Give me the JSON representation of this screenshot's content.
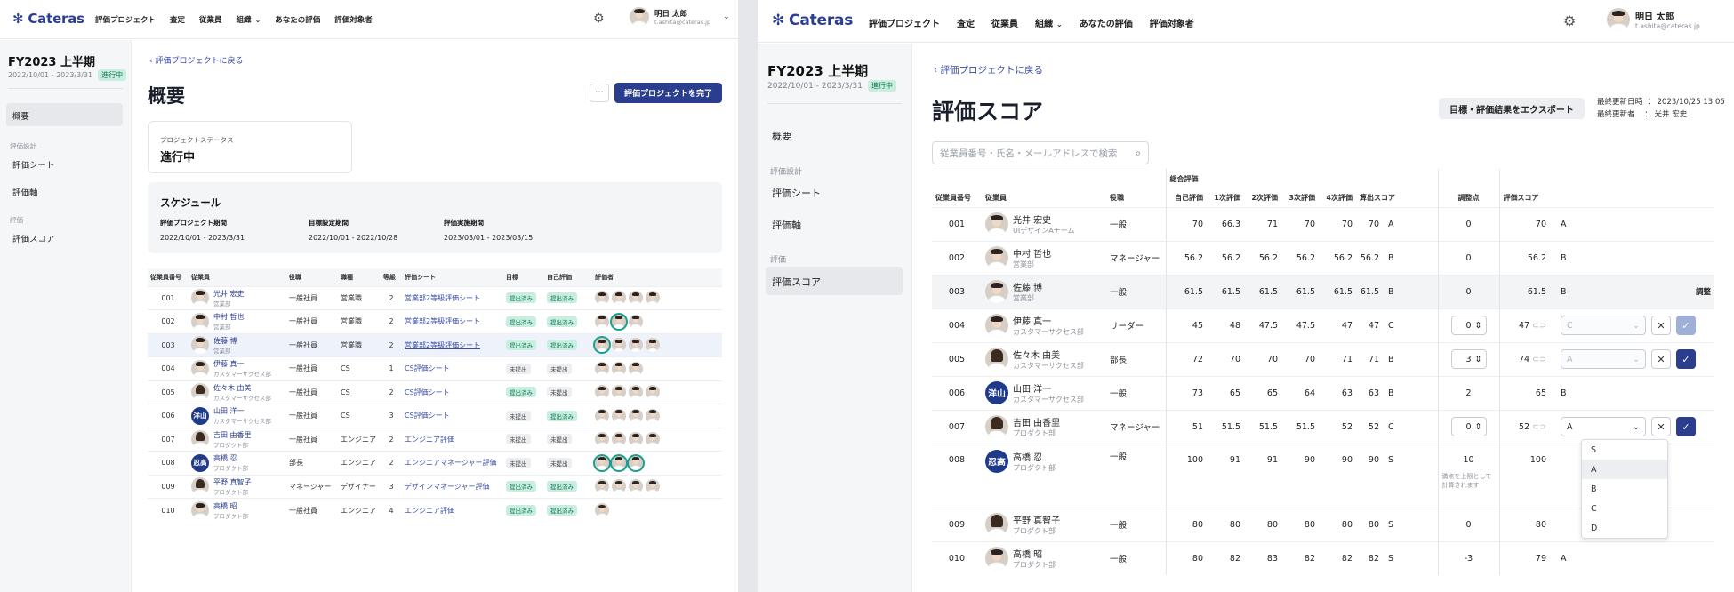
{
  "common": {
    "logo": "Cateras",
    "nav": [
      "評価プロジェクト",
      "査定",
      "従業員",
      "組織",
      "あなたの評価",
      "評価対象者"
    ],
    "user": {
      "name": "明日 太郎",
      "email": "t.ashita@cateras.jp"
    },
    "project": {
      "title": "FY2023 上半期",
      "period": "2022/10/01 - 2023/3/31",
      "status": "進行中"
    },
    "back": "評価プロジェクトに戻る",
    "sidebar": {
      "overview": "概要",
      "section1": "評価設計",
      "sheet": "評価シート",
      "axis": "評価軸",
      "section2": "評価",
      "score": "評価スコア"
    }
  },
  "overview": {
    "title": "概要",
    "complete_button": "評価プロジェクトを完了",
    "more": "···",
    "status_card": {
      "label": "プロジェクトステータス",
      "value": "進行中"
    },
    "schedule": {
      "title": "スケジュール",
      "items": [
        {
          "label": "評価プロジェクト期間",
          "value": "2022/10/01 - 2023/3/31"
        },
        {
          "label": "目標設定期間",
          "value": "2022/10/01 - 2022/10/28"
        },
        {
          "label": "評価実施期間",
          "value": "2023/03/01 - 2023/03/15"
        }
      ]
    },
    "table": {
      "headers": [
        "従業員番号",
        "従業員",
        "役職",
        "職種",
        "等級",
        "評価シート",
        "目標",
        "自己評価",
        "評価者"
      ],
      "rows": [
        {
          "id": "001",
          "name": "光井 宏史",
          "dept": "営業部",
          "role": "一般社員",
          "job": "営業職",
          "grade": "2",
          "sheet": "営業部2等級評価シート",
          "goal": "提出済み",
          "self": "提出済み",
          "ev": 4
        },
        {
          "id": "002",
          "name": "中村 哲也",
          "dept": "営業部",
          "role": "一般社員",
          "job": "営業職",
          "grade": "2",
          "sheet": "営業部2等級評価シート",
          "goal": "提出済み",
          "self": "提出済み",
          "ev": 3
        },
        {
          "id": "003",
          "name": "佐藤 博",
          "dept": "営業部",
          "role": "一般社員",
          "job": "営業職",
          "grade": "2",
          "sheet": "営業部2等級評価シート",
          "goal": "提出済み",
          "self": "提出済み",
          "ev": 4
        },
        {
          "id": "004",
          "name": "伊藤 真一",
          "dept": "カスタマーサクセス部",
          "role": "一般社員",
          "job": "CS",
          "grade": "1",
          "sheet": "CS評価シート",
          "goal": "未提出",
          "self": "未提出",
          "ev": 3
        },
        {
          "id": "005",
          "name": "佐々木 由美",
          "dept": "カスタマーサクセス部",
          "role": "一般社員",
          "job": "CS",
          "grade": "2",
          "sheet": "CS評価シート",
          "goal": "提出済み",
          "self": "未提出",
          "ev": 4
        },
        {
          "id": "006",
          "name": "山田 洋一",
          "dept": "カスタマーサクセス部",
          "role": "一般社員",
          "job": "CS",
          "grade": "3",
          "sheet": "CS評価シート",
          "goal": "未提出",
          "self": "提出済み",
          "ev": 4
        },
        {
          "id": "007",
          "name": "吉田 由香里",
          "dept": "プロダクト部",
          "role": "一般社員",
          "job": "エンジニア",
          "grade": "2",
          "sheet": "エンジニア評価",
          "goal": "未提出",
          "self": "未提出",
          "ev": 4
        },
        {
          "id": "008",
          "name": "高橋 忍",
          "dept": "プロダクト部",
          "role": "部長",
          "job": "エンジニア",
          "grade": "2",
          "sheet": "エンジニアマネージャー評価",
          "goal": "未提出",
          "self": "未提出",
          "ev": 3
        },
        {
          "id": "009",
          "name": "平野 真智子",
          "dept": "プロダクト部",
          "role": "マネージャー",
          "job": "デザイナー",
          "grade": "3",
          "sheet": "デザインマネージャー評価",
          "goal": "提出済み",
          "self": "提出済み",
          "ev": 4
        },
        {
          "id": "010",
          "name": "高橋 昭",
          "dept": "プロダクト部",
          "role": "一般社員",
          "job": "エンジニア",
          "grade": "4",
          "sheet": "エンジニア評価",
          "goal": "提出済み",
          "self": "提出済み",
          "ev": 1
        }
      ]
    }
  },
  "scores": {
    "title": "評価スコア",
    "export_button": "目標・評価結果をエクスポート",
    "updated_at_label": "最終更新日時",
    "updated_at": "2023/10/25 13:05",
    "updated_by_label": "最終更新者",
    "updated_by": "光井 宏史",
    "search_placeholder": "従業員番号・氏名・メールアドレスで検索",
    "header_group": "総合評価",
    "headers": [
      "従業員番号",
      "従業員",
      "役職",
      "自己評価",
      "1次評価",
      "2次評価",
      "3次評価",
      "4次評価",
      "算出スコア",
      "調整点",
      "評価スコア"
    ],
    "adjust_label": "調整",
    "note": "満点を上限として計算されます",
    "options": [
      "S",
      "A",
      "B",
      "C",
      "D"
    ],
    "rows": [
      {
        "id": "001",
        "name": "光井 宏史",
        "dept": "UIデザインAチーム",
        "role": "一般",
        "self": "70",
        "e1": "66.3",
        "e2": "71",
        "e3": "70",
        "e4": "70",
        "calc": "70",
        "grade": "A",
        "adj": "0",
        "score": "70",
        "sgrade": "A"
      },
      {
        "id": "002",
        "name": "中村 哲也",
        "dept": "営業部",
        "role": "マネージャー",
        "self": "56.2",
        "e1": "56.2",
        "e2": "56.2",
        "e3": "56.2",
        "e4": "56.2",
        "calc": "56.2",
        "grade": "B",
        "adj": "0",
        "score": "56.2",
        "sgrade": "B"
      },
      {
        "id": "003",
        "name": "佐藤 博",
        "dept": "営業部",
        "role": "一般",
        "self": "61.5",
        "e1": "61.5",
        "e2": "61.5",
        "e3": "61.5",
        "e4": "61.5",
        "calc": "61.5",
        "grade": "B",
        "adj": "0",
        "score": "61.5",
        "sgrade": "B"
      },
      {
        "id": "004",
        "name": "伊藤 真一",
        "dept": "カスタマーサクセス部",
        "role": "リーダー",
        "self": "45",
        "e1": "48",
        "e2": "47.5",
        "e3": "47.5",
        "e4": "47",
        "calc": "47",
        "grade": "C",
        "adj": "0",
        "score": "47",
        "sgrade": "C"
      },
      {
        "id": "005",
        "name": "佐々木 由美",
        "dept": "カスタマーサクセス部",
        "role": "部長",
        "self": "72",
        "e1": "70",
        "e2": "70",
        "e3": "70",
        "e4": "71",
        "calc": "71",
        "grade": "B",
        "adj": "3",
        "score": "74",
        "sgrade": "A"
      },
      {
        "id": "006",
        "name": "山田 洋一",
        "dept": "カスタマーサクセス部",
        "role": "一般",
        "self": "73",
        "e1": "65",
        "e2": "65",
        "e3": "64",
        "e4": "63",
        "calc": "63",
        "grade": "B",
        "adj": "2",
        "score": "65",
        "sgrade": "B"
      },
      {
        "id": "007",
        "name": "吉田 由香里",
        "dept": "プロダクト部",
        "role": "マネージャー",
        "self": "51",
        "e1": "51.5",
        "e2": "51.5",
        "e3": "51.5",
        "e4": "52",
        "calc": "52",
        "grade": "C",
        "adj": "0",
        "score": "52",
        "sgrade": "A"
      },
      {
        "id": "008",
        "name": "高橋 忍",
        "dept": "プロダクト部",
        "role": "一般",
        "self": "100",
        "e1": "91",
        "e2": "91",
        "e3": "90",
        "e4": "90",
        "calc": "90",
        "grade": "S",
        "adj": "10",
        "score": "100",
        "sgrade": ""
      },
      {
        "id": "009",
        "name": "平野 真智子",
        "dept": "プロダクト部",
        "role": "一般",
        "self": "80",
        "e1": "80",
        "e2": "80",
        "e3": "80",
        "e4": "80",
        "calc": "80",
        "grade": "S",
        "adj": "0",
        "score": "80",
        "sgrade": ""
      },
      {
        "id": "010",
        "name": "高橋 昭",
        "dept": "プロダクト部",
        "role": "一般",
        "self": "80",
        "e1": "82",
        "e2": "83",
        "e3": "82",
        "e4": "82",
        "calc": "82",
        "grade": "S",
        "adj": "-3",
        "score": "79",
        "sgrade": "A"
      }
    ]
  },
  "avatar_initials": {
    "yamada": "洋山",
    "takahashi": "忍高"
  },
  "colors": {
    "primary": "#2b3d8f",
    "link": "#3a4ca8",
    "green_tag": "#c9eedf",
    "teal_ring": "#1d9f8f"
  }
}
